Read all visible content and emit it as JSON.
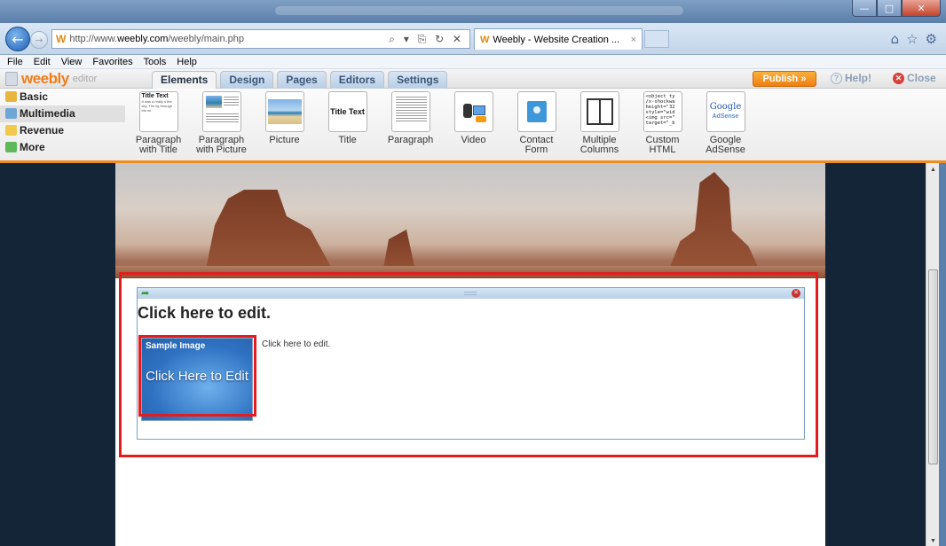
{
  "browser": {
    "url_prefix": "http://www.",
    "url_domain": "weebly.com",
    "url_path": "/weebly/main.php",
    "address_icons": "⌕ ▾ ⎘ ↻ ✕",
    "tab_title": "Weebly - Website Creation ...",
    "tab_close": "×",
    "favicon_letter": "W",
    "menu": [
      "File",
      "Edit",
      "View",
      "Favorites",
      "Tools",
      "Help"
    ]
  },
  "window": {
    "min": "—",
    "max": "□",
    "close": "✕"
  },
  "editor": {
    "logo_text": "weebly",
    "logo_sub": "editor",
    "tabs": [
      "Elements",
      "Design",
      "Pages",
      "Editors",
      "Settings"
    ],
    "publish_label": "Publish »",
    "help_label": "Help!",
    "close_label": "Close"
  },
  "categories": [
    {
      "label": "Basic",
      "color": "#e8b53d"
    },
    {
      "label": "Multimedia",
      "color": "#6ea6d8"
    },
    {
      "label": "Revenue",
      "color": "#f2c94c"
    },
    {
      "label": "More",
      "color": "#5fb85a"
    }
  ],
  "elements": [
    {
      "label": "Paragraph\nwith Title"
    },
    {
      "label": "Paragraph\nwith Picture"
    },
    {
      "label": "Picture"
    },
    {
      "label": "Title"
    },
    {
      "label": "Paragraph"
    },
    {
      "label": "Video"
    },
    {
      "label": "Contact\nForm"
    },
    {
      "label": "Multiple\nColumns"
    },
    {
      "label": "Custom\nHTML"
    },
    {
      "label": "Google\nAdSense"
    }
  ],
  "thumbs": {
    "para_title_heading": "Title Text",
    "para_title_body": "It was a really s the sky. The lig through the wi",
    "title_text": "Title Text",
    "html_code": "<object ty /x-shockwa height=\"32 style=\"wid <img src=\" target=\"_b",
    "google": "Google",
    "adsense": "AdSense"
  },
  "content": {
    "block_title": "Click here to edit.",
    "side_text": "Click here to edit.",
    "sample_caption": "Sample Image",
    "sample_main": "Click Here to Edit"
  }
}
